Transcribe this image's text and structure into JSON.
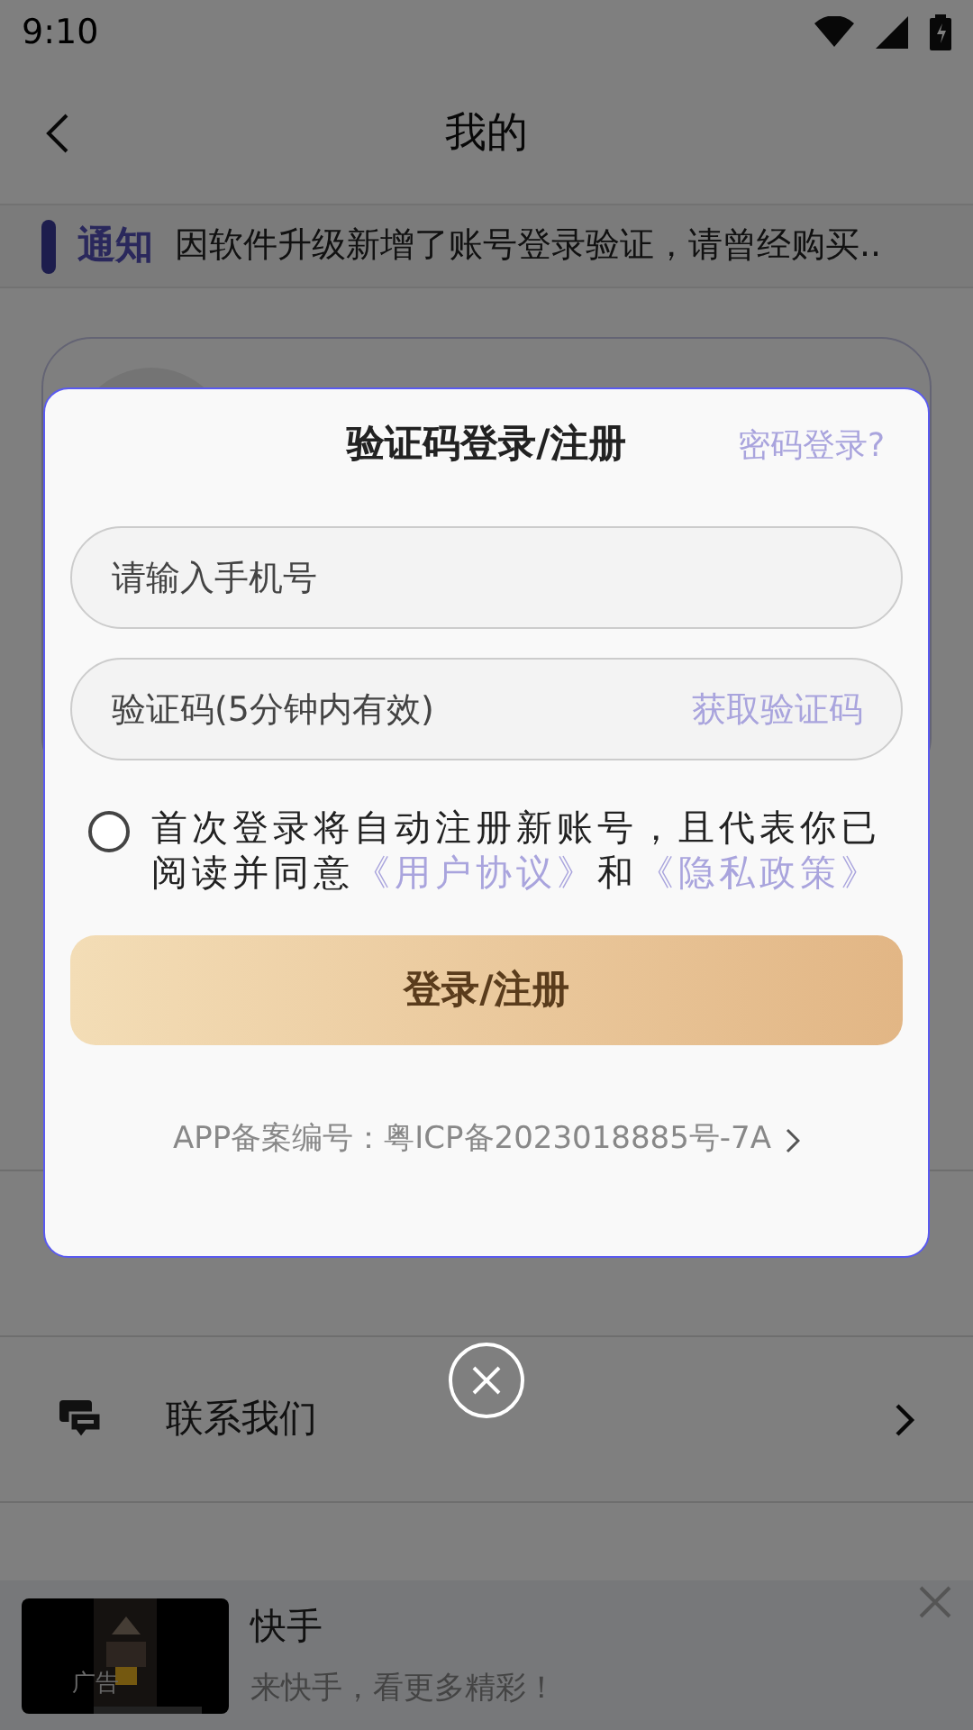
{
  "status_bar": {
    "time": "9:10"
  },
  "header": {
    "title": "我的"
  },
  "notice": {
    "label": "通知",
    "text": "因软件升级新增了账号登录验证，请曾经购买.."
  },
  "menu": [
    {
      "label": "联系我们",
      "kind": "chat"
    }
  ],
  "login_dialog": {
    "title": "验证码登录/注册",
    "switch_link": "密码登录?",
    "phone_field": {
      "placeholder": "请输入手机号"
    },
    "code_field": {
      "placeholder": "验证码(5分钟内有效)",
      "action": "获取验证码"
    },
    "agreement": {
      "checked": false,
      "text_before": "首次登录将自动注册新账号，且代表你已阅读并同意",
      "user_link": "《用户协议》",
      "middle": "和",
      "privacy_link": "《隐私政策》"
    },
    "submit": "登录/注册",
    "icp": "APP备案编号：粤ICP备2023018885号-7A"
  },
  "ad": {
    "title": "快手",
    "subtitle": "来快手，看更多精彩！",
    "badge": "广告"
  }
}
